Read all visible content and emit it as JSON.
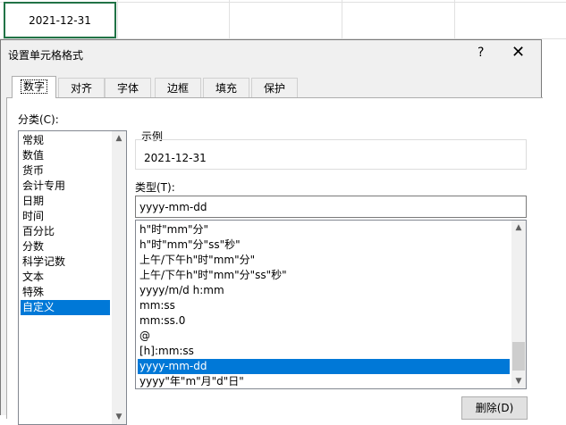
{
  "sheet": {
    "selected_cell_value": "2021-12-31"
  },
  "dialog": {
    "title": "设置单元格格式",
    "help_glyph": "?",
    "close_glyph": "✕",
    "tabs": [
      {
        "label": "数字",
        "active": true
      },
      {
        "label": "对齐",
        "active": false
      },
      {
        "label": "字体",
        "active": false
      },
      {
        "label": "边框",
        "active": false
      },
      {
        "label": "填充",
        "active": false
      },
      {
        "label": "保护",
        "active": false
      }
    ],
    "category_label": "分类(C):",
    "categories": [
      "常规",
      "数值",
      "货币",
      "会计专用",
      "日期",
      "时间",
      "百分比",
      "分数",
      "科学记数",
      "文本",
      "特殊",
      "自定义"
    ],
    "selected_category": "自定义",
    "sample_caption": "示例",
    "sample_value": "2021-12-31",
    "type_label": "类型(T):",
    "type_value": "yyyy-mm-dd",
    "formats": [
      "h\"时\"mm\"分\"",
      "h\"时\"mm\"分\"ss\"秒\"",
      "上午/下午h\"时\"mm\"分\"",
      "上午/下午h\"时\"mm\"分\"ss\"秒\"",
      "yyyy/m/d h:mm",
      "mm:ss",
      "mm:ss.0",
      "@",
      "[h]:mm:ss",
      "yyyy-mm-dd",
      "yyyy\"年\"m\"月\"d\"日\""
    ],
    "selected_format": "yyyy-mm-dd",
    "delete_button": "删除(D)"
  }
}
